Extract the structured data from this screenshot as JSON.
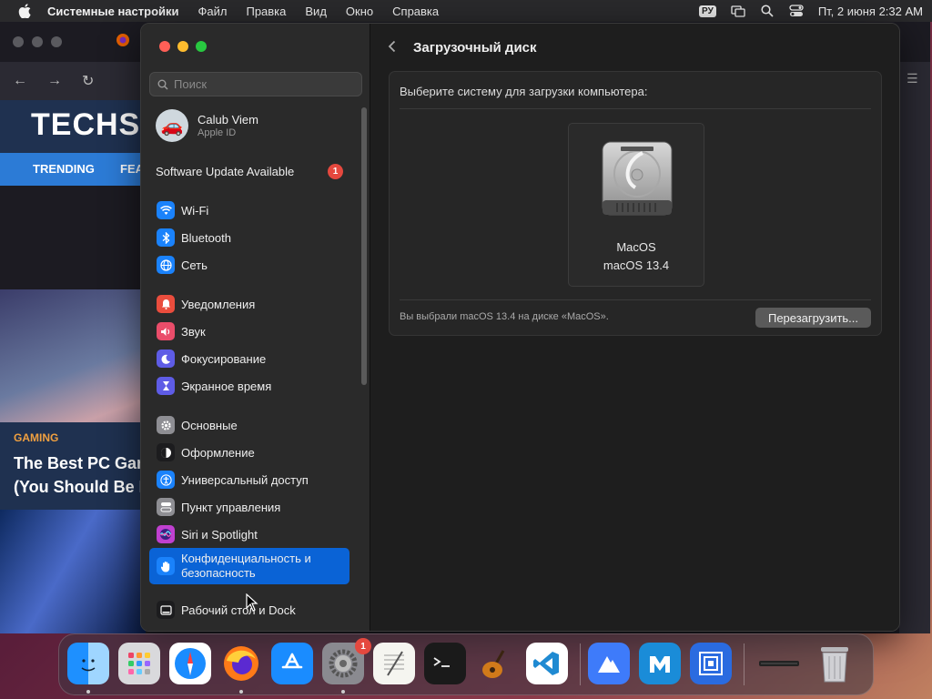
{
  "menubar": {
    "app_name": "Системные настройки",
    "items": [
      "Файл",
      "Правка",
      "Вид",
      "Окно",
      "Справка"
    ],
    "input_source": "РУ",
    "datetime": "Пт, 2 июня  2:32 AM"
  },
  "browser": {
    "site_logo": "TECHS",
    "nav_items": [
      "TRENDING",
      "FEA"
    ],
    "hero_category": "GAMING",
    "hero_headline_line1": "The Best PC Gam",
    "hero_headline_line2": "(You Should Be P"
  },
  "sidebar": {
    "search_placeholder": "Поиск",
    "account": {
      "name": "Calub Viem",
      "sub": "Apple ID"
    },
    "update": {
      "label": "Software Update Available",
      "badge": "1"
    },
    "groups": [
      [
        {
          "label": "Wi-Fi",
          "icon": "wifi-icon",
          "color": "#1a82fb"
        },
        {
          "label": "Bluetooth",
          "icon": "bluetooth-icon",
          "color": "#1a82fb"
        },
        {
          "label": "Сеть",
          "icon": "globe-icon",
          "color": "#1a82fb"
        }
      ],
      [
        {
          "label": "Уведомления",
          "icon": "bell-icon",
          "color": "#ea4d3d"
        },
        {
          "label": "Звук",
          "icon": "speaker-icon",
          "color": "#ea4d6a"
        },
        {
          "label": "Фокусирование",
          "icon": "moon-icon",
          "color": "#5e5ce6"
        },
        {
          "label": "Экранное время",
          "icon": "hourglass-icon",
          "color": "#5e5ce6"
        }
      ],
      [
        {
          "label": "Основные",
          "icon": "gear-icon",
          "color": "#8e8e93"
        },
        {
          "label": "Оформление",
          "icon": "appearance-icon",
          "color": "#1c1c1e"
        },
        {
          "label": "Универсальный доступ",
          "icon": "accessibility-icon",
          "color": "#1a82fb"
        },
        {
          "label": "Пункт управления",
          "icon": "control-center-icon",
          "color": "#8e8e93"
        },
        {
          "label": "Siri и Spotlight",
          "icon": "siri-icon",
          "color": "#c040d0"
        },
        {
          "label": "Конфиденциальность и безопасность",
          "icon": "hand-icon",
          "color": "#1a82fb",
          "selected": true
        }
      ],
      [
        {
          "label": "Рабочий стол и Dock",
          "icon": "dock-icon",
          "color": "#1c1c1e"
        }
      ]
    ]
  },
  "content": {
    "title": "Загрузочный диск",
    "prompt": "Выберите систему для загрузки компьютера:",
    "disk": {
      "name": "MacOS",
      "version": "macOS 13.4",
      "icon": "hard-drive-icon"
    },
    "status": "Вы выбрали macOS 13.4 на диске «MacOS».",
    "restart_label": "Перезагрузить..."
  },
  "dock": {
    "apps": [
      {
        "name": "Finder",
        "icon": "finder-icon",
        "running": true
      },
      {
        "name": "Launchpad",
        "icon": "launchpad-icon"
      },
      {
        "name": "Safari",
        "icon": "safari-icon"
      },
      {
        "name": "Firefox",
        "icon": "firefox-icon",
        "running": true
      },
      {
        "name": "App Store",
        "icon": "app-store-icon"
      },
      {
        "name": "System Settings",
        "icon": "system-settings-icon",
        "running": true,
        "badge": "1"
      },
      {
        "name": "TextEdit",
        "icon": "textedit-icon"
      },
      {
        "name": "Terminal",
        "icon": "terminal-icon"
      },
      {
        "name": "GarageBand",
        "icon": "garageband-icon"
      },
      {
        "name": "VS Code",
        "icon": "vscode-icon"
      },
      {
        "name": "NordVPN",
        "icon": "nordvpn-icon"
      },
      {
        "name": "Maxthon",
        "icon": "maxthon-icon"
      },
      {
        "name": "Remote",
        "icon": "remote-icon"
      },
      {
        "name": "Downloads",
        "icon": "downloads-stack-icon"
      },
      {
        "name": "Trash",
        "icon": "trash-icon"
      }
    ]
  }
}
